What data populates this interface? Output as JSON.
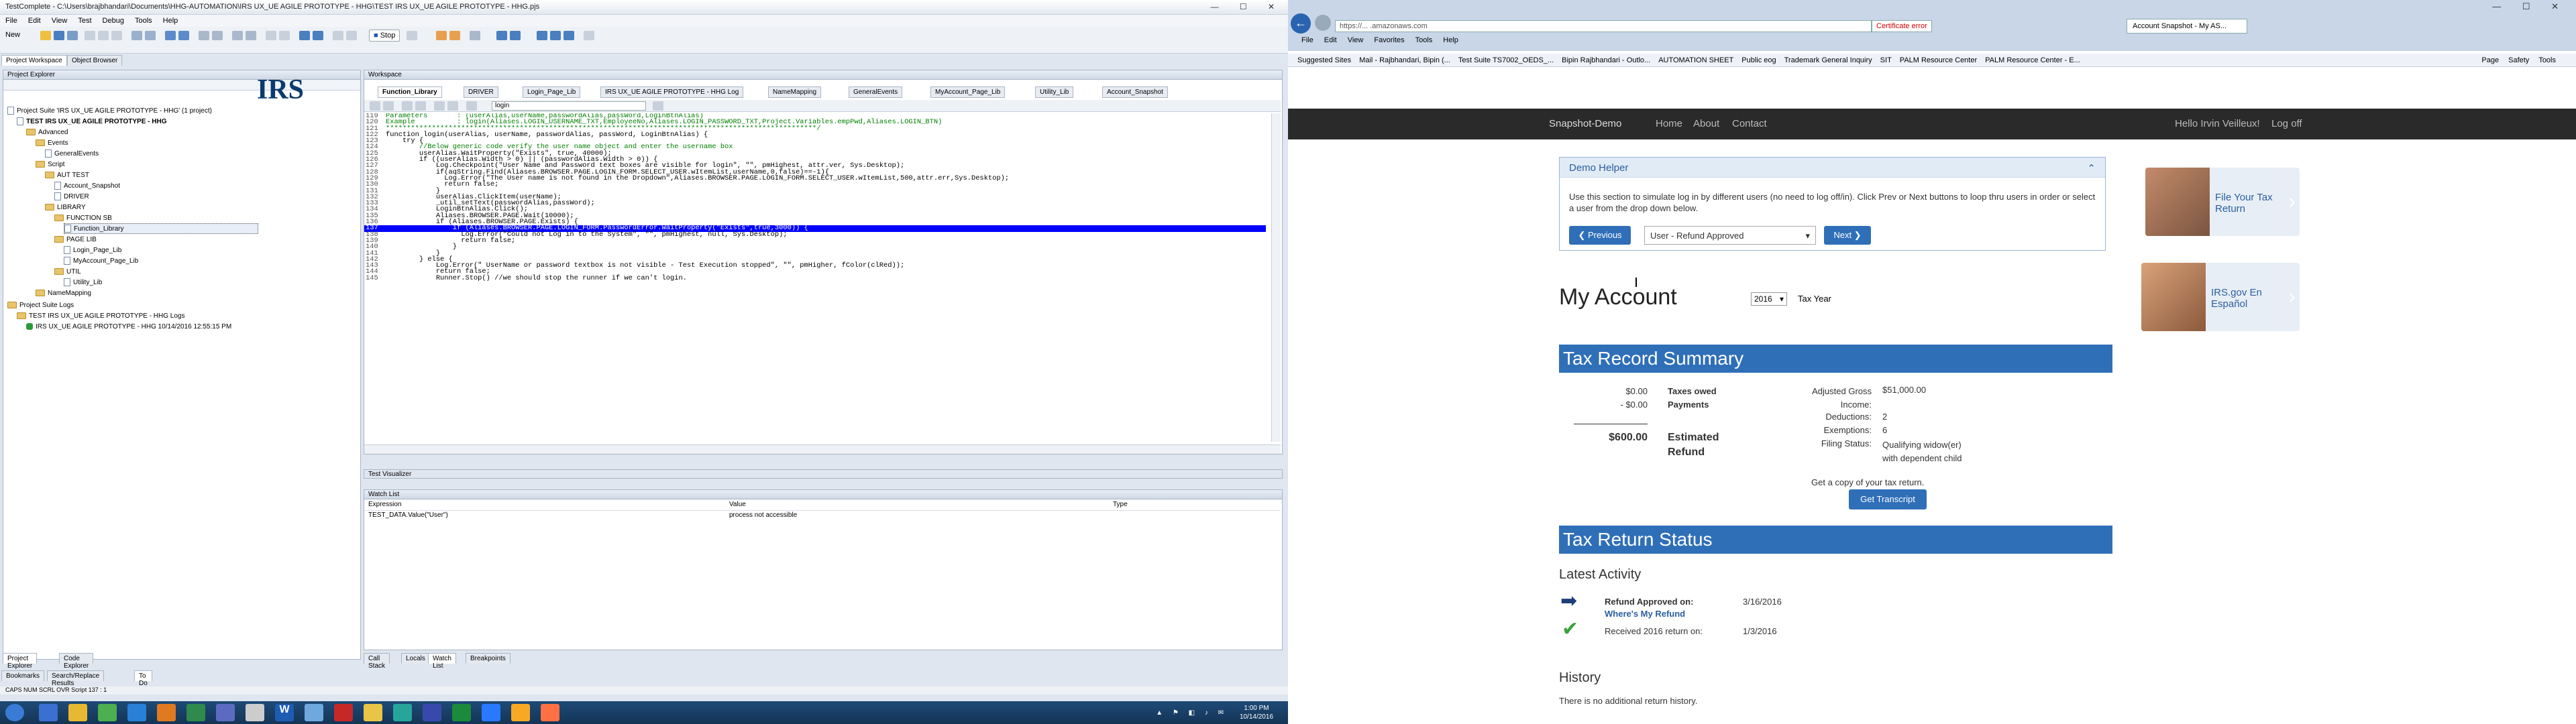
{
  "ide": {
    "title": "TestComplete - C:\\Users\\brajbhandari\\Documents\\HHG-AUTOMATION\\IRS UX_UE AGILE PROTOTYPE - HHG\\TEST IRS UX_UE AGILE PROTOTYPE - HHG.pjs",
    "menu": [
      "File",
      "Edit",
      "View",
      "Test",
      "Debug",
      "Tools",
      "Help"
    ],
    "new_label": "New",
    "stop_label": "Stop",
    "panel_tabs": [
      "Project Workspace",
      "Object Browser"
    ],
    "project_explorer_title": "Project Explorer",
    "tree": [
      "Project Suite 'IRS UX_UE AGILE PROTOTYPE - HHG' (1 project)",
      "TEST IRS UX_UE AGILE PROTOTYPE - HHG",
      "Advanced",
      "Events",
      "GeneralEvents",
      "Script",
      "AUT TEST",
      "Account_Snapshot",
      "DRIVER",
      "LIBRARY",
      "FUNCTION SB",
      "Function_Library",
      "PAGE LIB",
      "Login_Page_Lib",
      "MyAccount_Page_Lib",
      "UTIL",
      "Utility_Lib",
      "NameMapping",
      "Project Suite Logs",
      "TEST IRS UX_UE AGILE PROTOTYPE - HHG Logs",
      "IRS UX_UE AGILE PROTOTYPE - HHG 10/14/2016 12:55:15 PM"
    ],
    "explorer_bottom_tabs": [
      "Project Explorer",
      "Code Explorer"
    ],
    "workspace_title": "Workspace",
    "editor_tabs": [
      "Function_Library",
      "DRIVER",
      "Login_Page_Lib",
      "IRS UX_UE AGILE PROTOTYPE - HHG Log",
      "NameMapping",
      "GeneralEvents",
      "MyAccount_Page_Lib",
      "Utility_Lib",
      "Account_Snapshot"
    ],
    "function_selector": "login",
    "code_lines": [
      {
        "n": "119",
        "t": "Parameters       : (userAlias,userName,passwordAlias,passWord,LoginBtnAlias)"
      },
      {
        "n": "120",
        "t": "Example          : login(Aliases.LOGIN_USERNAME_TXT,EmployeeNo,Aliases.LOGIN_PASSWORD_TXT,Project.Variables.empPwd,Aliases.LOGIN_BTN)"
      },
      {
        "n": "121",
        "t": "*******************************************************************************************************/"
      },
      {
        "n": "122",
        "t": "function login(userAlias, userName, passwordAlias, passWord, LoginBtnAlias) {"
      },
      {
        "n": "123",
        "t": "    try {"
      },
      {
        "n": "124",
        "t": "        //Below generic code verify the user name object and enter the username box"
      },
      {
        "n": "125",
        "t": "        userAlias.WaitProperty(\"Exists\", true, 40000);"
      },
      {
        "n": "126",
        "t": "        if ((userAlias.Width > 0) || (passwordAlias.Width > 0)) {"
      },
      {
        "n": "127",
        "t": "            Log.Checkpoint(\"User Name and Password text boxes are visible for login\", \"\", pmHighest, attr.ver, Sys.Desktop);"
      },
      {
        "n": "128",
        "t": "            if(aqString.Find(Aliases.BROWSER.PAGE.LOGIN_FORM.SELECT_USER.wItemList,userName,0,false)==-1){"
      },
      {
        "n": "129",
        "t": "              Log.Error(\"The User name is not found in the Dropdown\",Aliases.BROWSER.PAGE.LOGIN_FORM.SELECT_USER.wItemList,500,attr.err,Sys.Desktop);"
      },
      {
        "n": "130",
        "t": "              return false;"
      },
      {
        "n": "131",
        "t": "            }"
      },
      {
        "n": "132",
        "t": "            userAlias.ClickItem(userName);"
      },
      {
        "n": "133",
        "t": "            _util_setText(passwordAlias,passWord);"
      },
      {
        "n": "134",
        "t": "            LoginBtnAlias.Click();"
      },
      {
        "n": "135",
        "t": "            Aliases.BROWSER.PAGE.Wait(10000);"
      },
      {
        "n": "136",
        "t": "            if (Aliases.BROWSER.PAGE.Exists) {"
      },
      {
        "n": "137",
        "t": "                if (Aliases.BROWSER.PAGE.LOGIN_FORM.PasswordError.WaitProperty(\"Exists\",true,3000)) {"
      },
      {
        "n": "138",
        "t": "                  Log.Error(\"Could not Log in to the System\", \"\", pmHighest, null, Sys.Desktop);"
      },
      {
        "n": "139",
        "t": "                  return false;"
      },
      {
        "n": "140",
        "t": "                }"
      },
      {
        "n": "141",
        "t": "            }"
      },
      {
        "n": "142",
        "t": "        } else {"
      },
      {
        "n": "143",
        "t": "            Log.Error(\" UserName or password textbox is not visible - Test Execution stopped\", \"\", pmHigher, fColor(clRed));"
      },
      {
        "n": "144",
        "t": "            return false;"
      },
      {
        "n": "145",
        "t": "            Runner.Stop() //we should stop the runner if we can't login."
      }
    ],
    "highlight_line": "137",
    "test_visualizer": "Test Visualizer",
    "watch_list_title": "Watch List",
    "watch_cols": [
      "Expression",
      "Value",
      "Type"
    ],
    "watch_row": {
      "expr": "TEST_DATA.Value(\"User\")",
      "value": "process not accessible",
      "type": ""
    },
    "bottom_tabs": [
      "Call Stack",
      "Locals",
      "Watch List",
      "Breakpoints"
    ],
    "bookmark_tabs": [
      "Bookmarks",
      "Search/Replace Results",
      "To Do"
    ],
    "status": "CAPS  NUM  SCRL  OVR  Script  137 : 1"
  },
  "taskbar": {
    "time": "1:00 PM",
    "date": "10/14/2016"
  },
  "browser": {
    "url": "https://... .amazonaws.com",
    "cert": "Certificate error",
    "tab_title": "Account Snapshot - My AS...",
    "menu": [
      "File",
      "Edit",
      "View",
      "Favorites",
      "Tools",
      "Help"
    ],
    "favorites": [
      "Suggested Sites",
      "Mail - Rajbhandari, Bipin (...",
      "Test Suite TS7002_OEDS_...",
      "Bipin Rajbhandari - Outlo...",
      "AUTOMATION SHEET",
      "Public eog",
      "Trademark General Inquiry",
      "SIT",
      "PALM Resource Center",
      "PALM Resource Center - E..."
    ],
    "tools": [
      "Page",
      "Safety",
      "Tools"
    ]
  },
  "irs": {
    "logo": "IRS",
    "site_name": "Snapshot-Demo",
    "nav": [
      "Home",
      "About",
      "Contact"
    ],
    "user": "Hello Irvin Veilleux!",
    "logoff": "Log off",
    "demo_title": "Demo Helper",
    "demo_text": "Use this section to simulate log in by different users (no need to log off/in). Click Prev or Next buttons to loop thru users in order or select a user from the drop down below.",
    "prev": "Previous",
    "next": "Next",
    "user_select": "User - Refund Approved",
    "my_account": "My Account",
    "year": "2016",
    "tax_year": "Tax Year",
    "summary_title": "Tax Record Summary",
    "taxes_owed_amt": "$0.00",
    "taxes_owed": "Taxes owed",
    "payments_amt": "- $0.00",
    "payments": "Payments",
    "refund_amt": "$600.00",
    "refund": "Estimated Refund",
    "details": [
      {
        "k": "Adjusted Gross Income:",
        "v": "$51,000.00"
      },
      {
        "k": "Deductions:",
        "v": "2"
      },
      {
        "k": "Exemptions:",
        "v": "6"
      },
      {
        "k": "Filing Status:",
        "v": "Qualifying widow(er) with dependent child"
      }
    ],
    "copy_text": "Get a copy of your tax return.",
    "transcript": "Get Transcript",
    "status_title": "Tax Return Status",
    "latest": "Latest Activity",
    "act1_label": "Refund Approved on:",
    "act1_date": "3/16/2016",
    "act1_link": "Where's My Refund",
    "act2_label": "Received 2016 return on:",
    "act2_date": "1/3/2016",
    "history": "History",
    "history_text": "There is no additional return history.",
    "side1": "File Your Tax Return",
    "side2": "IRS.gov En Español"
  }
}
